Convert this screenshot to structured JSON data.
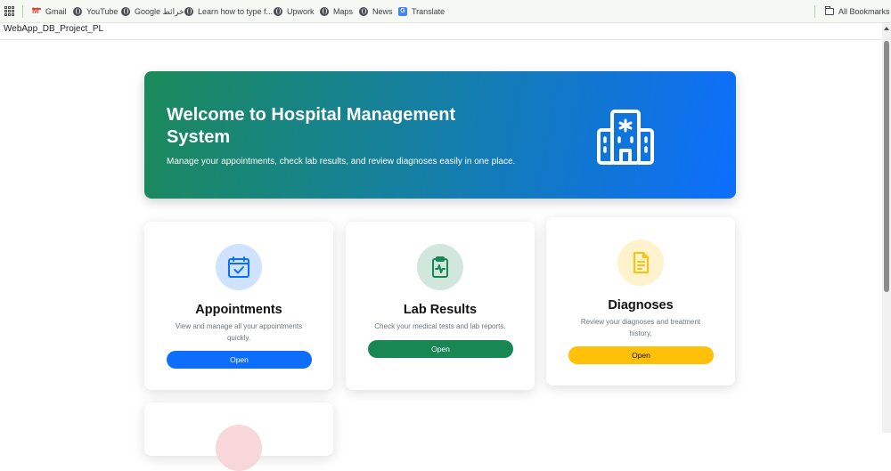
{
  "bookmarks": {
    "items": [
      {
        "label": "Gmail",
        "icon": "gmail-icon"
      },
      {
        "label": "YouTube",
        "icon": "globe-icon"
      },
      {
        "label": "Google خرائط",
        "icon": "globe-icon"
      },
      {
        "label": "Learn how to type f...",
        "icon": "globe-icon"
      },
      {
        "label": "Upwork",
        "icon": "globe-icon"
      },
      {
        "label": "Maps",
        "icon": "globe-icon"
      },
      {
        "label": "News",
        "icon": "globe-icon"
      },
      {
        "label": "Translate",
        "icon": "translate-icon"
      }
    ],
    "all_bookmarks": "All Bookmarks"
  },
  "page": {
    "title": "WebApp_DB_Project_PL"
  },
  "hero": {
    "title": "Welcome to Hospital Management System",
    "subtitle": "Manage your appointments, check lab results, and review diagnoses easily in one place.",
    "icon": "hospital-icon"
  },
  "cards": [
    {
      "title": "Appointments",
      "description": "View and manage all your appointments quickly.",
      "button": "Open",
      "icon": "calendar-check-icon",
      "accent": "#0d6efd",
      "tint": "#cfe2ff"
    },
    {
      "title": "Lab Results",
      "description": "Check your medical tests and lab reports.",
      "button": "Open",
      "icon": "clipboard-pulse-icon",
      "accent": "#198754",
      "tint": "#d1e7dd"
    },
    {
      "title": "Diagnoses",
      "description": "Review your diagnoses and treatment history.",
      "button": "Open",
      "icon": "file-medical-icon",
      "accent": "#ffc107",
      "tint": "#fff3cd"
    }
  ]
}
